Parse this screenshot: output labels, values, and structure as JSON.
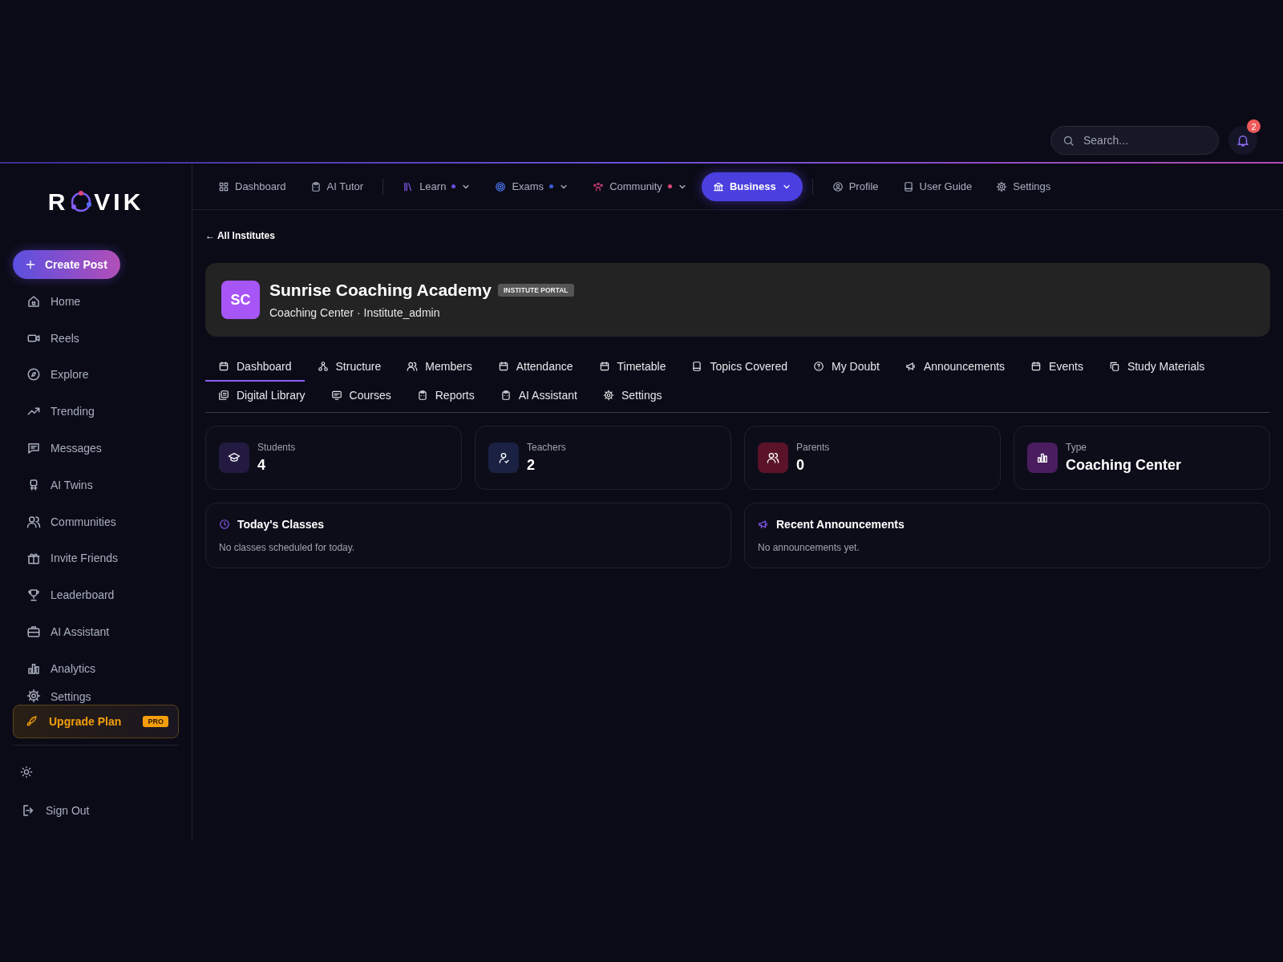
{
  "topbar": {
    "search": {
      "placeholder": "Search..."
    },
    "notifications": {
      "count": "2"
    }
  },
  "logo": {
    "left": "R",
    "right": "VIK"
  },
  "create_button": {
    "label": "Create Post"
  },
  "sidebar": {
    "items": [
      {
        "label": "Home"
      },
      {
        "label": "Reels"
      },
      {
        "label": "Explore"
      },
      {
        "label": "Trending"
      },
      {
        "label": "Messages"
      },
      {
        "label": "AI Twins"
      },
      {
        "label": "Communities"
      },
      {
        "label": "Invite Friends"
      },
      {
        "label": "Leaderboard"
      },
      {
        "label": "AI Assistant"
      },
      {
        "label": "Analytics"
      },
      {
        "label": "Settings"
      }
    ]
  },
  "upgrade": {
    "label": "Upgrade Plan",
    "badge": "PRO"
  },
  "sign_out": {
    "label": "Sign Out"
  },
  "nav": {
    "groups": [
      [
        {
          "label": "Dashboard",
          "selected": false,
          "dropdown": false
        },
        {
          "label": "AI Tutor",
          "selected": false,
          "dropdown": false
        }
      ],
      [
        {
          "label": "Learn",
          "selected": false,
          "dropdown": true,
          "color": "#6a4fe0"
        },
        {
          "label": "Exams",
          "selected": false,
          "dropdown": true,
          "color": "#3d5bd9"
        },
        {
          "label": "Community",
          "selected": false,
          "dropdown": true,
          "color": "#e0457b"
        },
        {
          "label": "Business",
          "selected": true,
          "dropdown": true
        }
      ],
      [
        {
          "label": "Profile",
          "selected": false,
          "dropdown": false
        },
        {
          "label": "User Guide",
          "selected": false,
          "dropdown": false
        },
        {
          "label": "Settings",
          "selected": false,
          "dropdown": false
        }
      ]
    ]
  },
  "back_link": "← All Institutes",
  "institute": {
    "initials": "SC",
    "name": "Sunrise Coaching Academy",
    "badge": "INSTITUTE PORTAL",
    "subtitle": "Coaching Center · Institute_admin"
  },
  "tabs": [
    {
      "label": "Dashboard",
      "selected": true
    },
    {
      "label": "Structure",
      "selected": false
    },
    {
      "label": "Members",
      "selected": false
    },
    {
      "label": "Attendance",
      "selected": false
    },
    {
      "label": "Timetable",
      "selected": false
    },
    {
      "label": "Topics Covered",
      "selected": false
    },
    {
      "label": "My Doubt",
      "selected": false
    },
    {
      "label": "Announcements",
      "selected": false
    },
    {
      "label": "Events",
      "selected": false
    },
    {
      "label": "Study Materials",
      "selected": false
    },
    {
      "label": "Digital Library",
      "selected": false
    },
    {
      "label": "Courses",
      "selected": false
    },
    {
      "label": "Reports",
      "selected": false
    },
    {
      "label": "AI Assistant",
      "selected": false
    },
    {
      "label": "Settings",
      "selected": false
    }
  ],
  "stats": [
    {
      "label": "Students",
      "value": "4",
      "color": "#221a40"
    },
    {
      "label": "Teachers",
      "value": "2",
      "color": "#1a2142"
    },
    {
      "label": "Parents",
      "value": "0",
      "color": "#5a1329"
    },
    {
      "label": "Type",
      "value": "Coaching Center",
      "color": "#4a1d5e"
    }
  ],
  "panels": [
    {
      "title": "Today's Classes",
      "empty_text": "No classes scheduled for today."
    },
    {
      "title": "Recent Announcements",
      "empty_text": "No announcements yet."
    }
  ]
}
